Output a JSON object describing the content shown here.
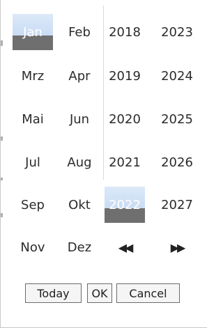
{
  "months": {
    "items": [
      "Jan",
      "Feb",
      "Mrz",
      "Apr",
      "Mai",
      "Jun",
      "Jul",
      "Aug",
      "Sep",
      "Okt",
      "Nov",
      "Dez"
    ],
    "selected": "Jan"
  },
  "years": {
    "items": [
      "2018",
      "2023",
      "2019",
      "2024",
      "2020",
      "2025",
      "2021",
      "2026",
      "2022",
      "2027"
    ],
    "selected": "2022",
    "prev_icon": "double-left-arrow",
    "next_icon": "double-right-arrow",
    "prev_glyph": "◀◀",
    "next_glyph": "▶▶"
  },
  "buttons": {
    "today": "Today",
    "ok": "OK",
    "cancel": "Cancel"
  },
  "colors": {
    "selected_top": "#c9dcf3",
    "selected_bottom": "#6f6f6f"
  }
}
